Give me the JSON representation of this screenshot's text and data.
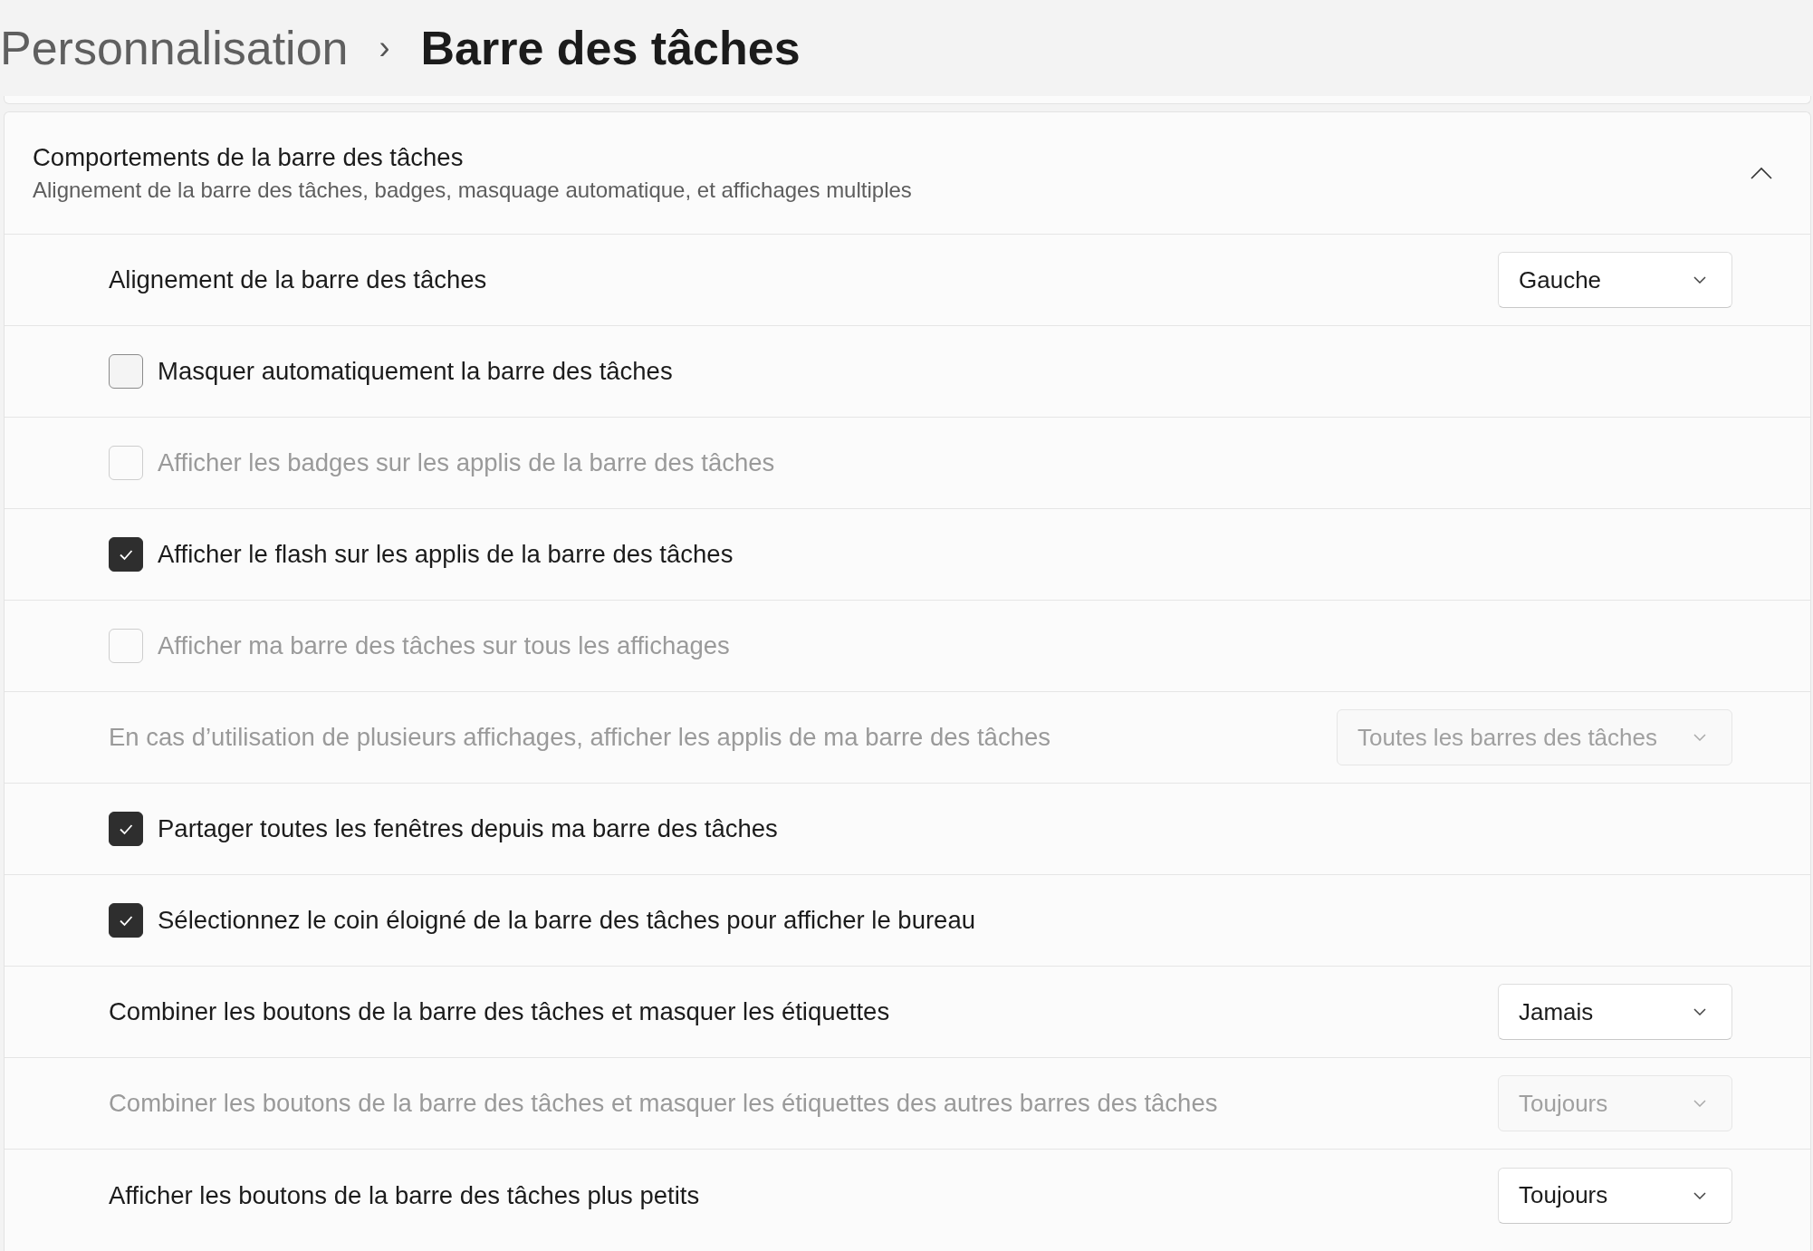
{
  "breadcrumb": {
    "parent": "Personnalisation",
    "separator": "›",
    "current": "Barre des tâches"
  },
  "section": {
    "title": "Comportements de la barre des tâches",
    "subtitle": "Alignement de la barre des tâches, badges, masquage automatique, et affichages multiples",
    "expanded": true
  },
  "rows": [
    {
      "kind": "dropdown",
      "label": "Alignement de la barre des tâches",
      "value": "Gauche",
      "disabled": false
    },
    {
      "kind": "checkbox",
      "label": "Masquer automatiquement la barre des tâches",
      "checked": false,
      "disabled": false
    },
    {
      "kind": "checkbox",
      "label": "Afficher les badges sur les applis de la barre des tâches",
      "checked": false,
      "disabled": true
    },
    {
      "kind": "checkbox",
      "label": "Afficher le flash sur les applis de la barre des tâches",
      "checked": true,
      "disabled": false
    },
    {
      "kind": "checkbox",
      "label": "Afficher ma barre des tâches sur tous les affichages",
      "checked": false,
      "disabled": true
    },
    {
      "kind": "dropdown",
      "label": "En cas d’utilisation de plusieurs affichages, afficher les applis de ma barre des tâches",
      "value": "Toutes les barres des tâches",
      "disabled": true
    },
    {
      "kind": "checkbox",
      "label": "Partager toutes les fenêtres depuis ma barre des tâches",
      "checked": true,
      "disabled": false
    },
    {
      "kind": "checkbox",
      "label": "Sélectionnez le coin éloigné de la barre des tâches pour afficher le bureau",
      "checked": true,
      "disabled": false
    },
    {
      "kind": "dropdown",
      "label": "Combiner les boutons de la barre des tâches et masquer les étiquettes",
      "value": "Jamais",
      "disabled": false
    },
    {
      "kind": "dropdown",
      "label": "Combiner les boutons de la barre des tâches et masquer les étiquettes des autres barres des tâches",
      "value": "Toujours",
      "disabled": true
    },
    {
      "kind": "dropdown",
      "label": "Afficher les boutons de la barre des tâches plus petits",
      "value": "Toujours",
      "disabled": false
    }
  ]
}
